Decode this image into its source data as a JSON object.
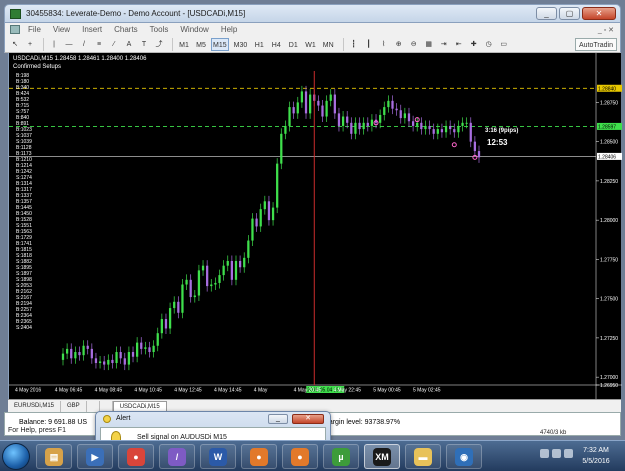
{
  "window": {
    "title": "30455834: Leverate-Demo - Demo Account - [USDCADi,M15]",
    "buttons": {
      "minimize": "_",
      "restore": "▢",
      "close": "✕"
    }
  },
  "menu": {
    "items": [
      "File",
      "View",
      "Insert",
      "Charts",
      "Tools",
      "Window",
      "Help"
    ],
    "right": "_ ▫ ✕"
  },
  "toolbar": {
    "timeframes": [
      "M1",
      "M5",
      "M15",
      "M30",
      "H1",
      "H4",
      "D1",
      "W1",
      "MN"
    ],
    "active_timeframe": "M15",
    "autotrading": "AutoTradin"
  },
  "chart": {
    "header": "USDCADi,M15  1.28458 1.28461 1.28400 1.28406",
    "subheader": "Confirmed Setups",
    "annotation_pips": "3:16 (9pips)",
    "annotation_time": "12:53",
    "x_highlight": "2016.05.04 15:15",
    "row_labels": [
      "B:198",
      "B:180",
      "B:340",
      "B:424",
      "B:532",
      "B:715",
      "S:757",
      "B:840",
      "B:891",
      "B:1023",
      "S:1037",
      "S:1039",
      "B:1128",
      "B:1173",
      "B:1210",
      "B:1214",
      "B:1242",
      "S:1274",
      "B:1314",
      "B:1317",
      "B:1337",
      "B:1357",
      "B:1445",
      "B:1450",
      "B:1528",
      "S:1551",
      "B:1563",
      "B:1729",
      "B:1741",
      "B:1815",
      "S:1818",
      "S:1882",
      "S:1895",
      "S:1897",
      "S:1898",
      "S:2053",
      "B:2162",
      "S:2167",
      "B:2194",
      "B:2257",
      "B:2364",
      "B:2365",
      "S:2404"
    ],
    "price_labels": [
      "1.28750",
      "1.28500",
      "1.28250",
      "1.28000",
      "1.27750",
      "1.27500",
      "1.27250",
      "1.27000",
      "1.26950"
    ],
    "price_box_yellow": "1.28840",
    "price_box_green": "1.28597",
    "price_box_white": "1.28406",
    "x_labels": [
      "4 May 2016",
      "4 May 06:45",
      "4 May 08:45",
      "4 May 10:45",
      "4 May 12:45",
      "4 May 14:45",
      "4 May",
      "4 May 20:45",
      "4 May 22:45",
      "5 May 00:45",
      "5 May 02:45"
    ]
  },
  "chart_data": {
    "type": "candlestick",
    "symbol": "USDCADi",
    "timeframe": "M15",
    "ylim": [
      1.2695,
      1.2895
    ],
    "y_ticks": [
      1.2875,
      1.285,
      1.2825,
      1.28,
      1.2775,
      1.275,
      1.2725,
      1.27
    ],
    "levels": [
      {
        "value": 1.2884,
        "color": "#e8c800",
        "style": "dashed"
      },
      {
        "value": 1.28597,
        "color": "#3fe04c",
        "style": "dashed"
      },
      {
        "value": 1.28406,
        "color": "#e0e0e0",
        "style": "solid"
      }
    ],
    "closes": [
      1.2715,
      1.2718,
      1.2712,
      1.2716,
      1.2714,
      1.272,
      1.2718,
      1.2712,
      1.2709,
      1.271,
      1.2708,
      1.2711,
      1.2709,
      1.2716,
      1.2712,
      1.2708,
      1.2716,
      1.2713,
      1.2722,
      1.2718,
      1.2719,
      1.2716,
      1.272,
      1.2728,
      1.2737,
      1.2731,
      1.2744,
      1.2748,
      1.2741,
      1.2759,
      1.2762,
      1.2751,
      1.2752,
      1.2768,
      1.2771,
      1.2758,
      1.2759,
      1.276,
      1.2765,
      1.2771,
      1.2774,
      1.2762,
      1.2774,
      1.277,
      1.2776,
      1.2787,
      1.2801,
      1.2796,
      1.2807,
      1.2812,
      1.28,
      1.2808,
      1.2836,
      1.2855,
      1.286,
      1.2872,
      1.2868,
      1.2875,
      1.2882,
      1.2868,
      1.288,
      1.2876,
      1.2873,
      1.2866,
      1.2876,
      1.288,
      1.2868,
      1.286,
      1.2866,
      1.2862,
      1.2855,
      1.2862,
      1.2858,
      1.2862,
      1.286,
      1.2864,
      1.2862,
      1.2867,
      1.2872,
      1.2876,
      1.2871,
      1.287,
      1.2865,
      1.2868,
      1.2863,
      1.286,
      1.2862,
      1.2858,
      1.286,
      1.2858,
      1.2855,
      1.2858,
      1.2856,
      1.286,
      1.2858,
      1.2856,
      1.286,
      1.2862,
      1.2862,
      1.285,
      1.2844,
      1.284
    ],
    "bull_color": "#3fe04c",
    "bear_color": "#a86ee0",
    "x_highlight_index": 61
  },
  "tabs": [
    "EURUSDi,M15",
    "GBP",
    "",
    "",
    "USDCADi,M15"
  ],
  "active_tab": "USDCADi,M15",
  "terminal": {
    "balance": "Balance: 9 691.88 US",
    "margin_level": "Margin level: 93738.97%",
    "status_left": "For Help, press F1",
    "status_right": "4740/3 kb"
  },
  "alert": {
    "title": "Alert",
    "message": "Sell signal on AUDUSDi M15",
    "min": "_",
    "close": "✕"
  },
  "taskbar": {
    "apps": [
      {
        "name": "explorer",
        "glyph": "▤",
        "color": "#d7a24a"
      },
      {
        "name": "media-player",
        "glyph": "▶",
        "color": "#3b6fb8"
      },
      {
        "name": "chrome",
        "glyph": "●",
        "color": "#d9453a"
      },
      {
        "name": "feather",
        "glyph": "/",
        "color": "#7e5bc4"
      },
      {
        "name": "word",
        "glyph": "W",
        "color": "#2b5aa8"
      },
      {
        "name": "firefox",
        "glyph": "●",
        "color": "#e2792a"
      },
      {
        "name": "firefox-2",
        "glyph": "●",
        "color": "#e2792a"
      },
      {
        "name": "utorrent",
        "glyph": "µ",
        "color": "#3d9c3a"
      },
      {
        "name": "xm",
        "glyph": "XM",
        "color": "#1a1a1a"
      },
      {
        "name": "folder",
        "glyph": "▬",
        "color": "#e8c25a"
      },
      {
        "name": "media-center",
        "glyph": "◉",
        "color": "#2f6fb8"
      }
    ],
    "time": "7:32 AM",
    "date": "5/5/2016"
  }
}
